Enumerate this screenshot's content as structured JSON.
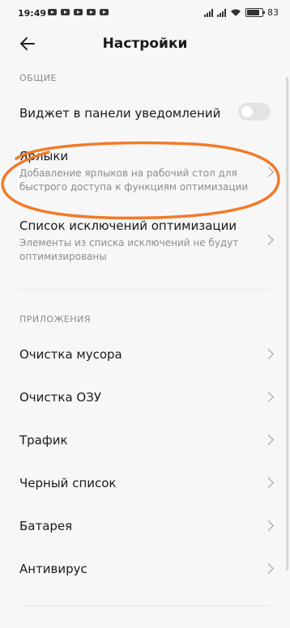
{
  "status": {
    "time": "19:49",
    "battery": "83",
    "battery_level": 0.83
  },
  "header": {
    "title": "Настройки",
    "back_icon": "arrow-left-icon"
  },
  "sections": {
    "general": "ОБЩИЕ",
    "apps": "ПРИЛОЖЕНИЯ"
  },
  "general": {
    "widget": {
      "title": "Виджет в панели уведомлений",
      "enabled": false
    },
    "shortcuts": {
      "title": "Ярлыки",
      "subtitle": "Добавление ярлыков на рабочий стол для быстрого доступа к функциям оптимизации"
    },
    "exclusions": {
      "title": "Список исключений оптимизации",
      "subtitle": "Элементы из списка исключений не будут оптимизированы"
    }
  },
  "apps": [
    {
      "label": "Очистка мусора"
    },
    {
      "label": "Очистка ОЗУ"
    },
    {
      "label": "Трафик"
    },
    {
      "label": "Черный список"
    },
    {
      "label": "Батарея"
    },
    {
      "label": "Антивирус"
    }
  ],
  "colors": {
    "annotation": "#f07b2a"
  }
}
